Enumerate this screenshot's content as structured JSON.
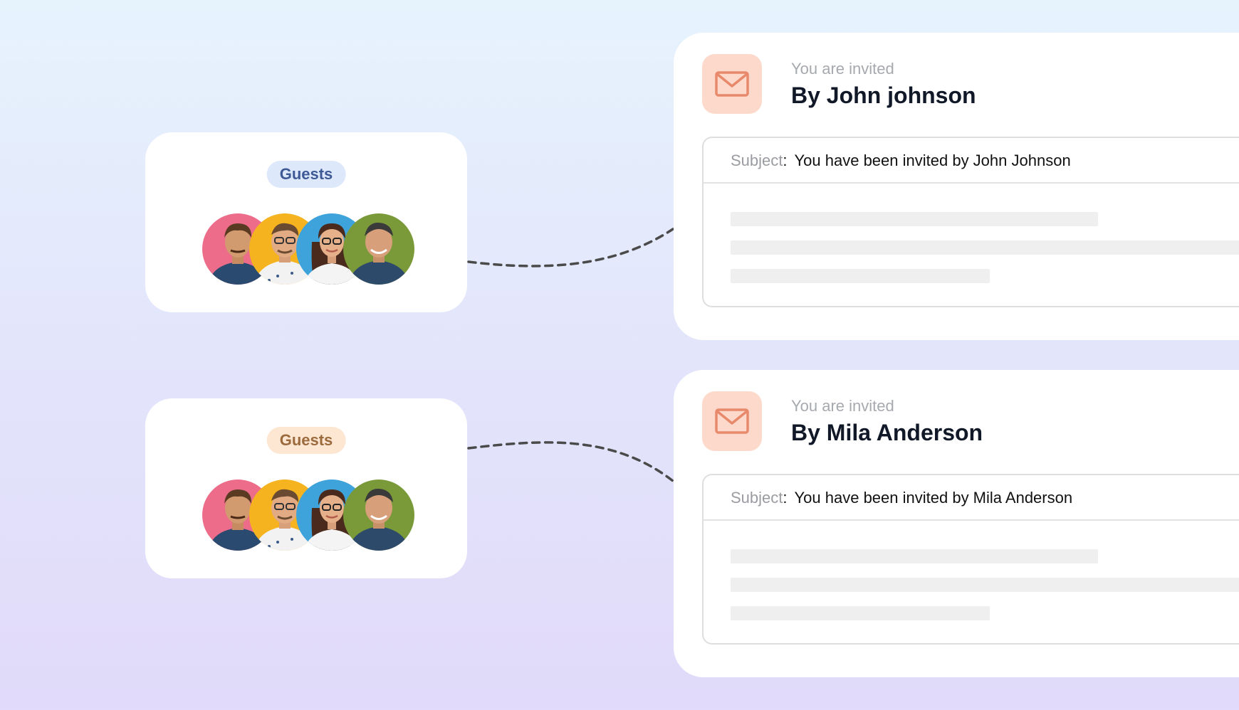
{
  "colors": {
    "background_top": "#e6f3fd",
    "background_bottom": "#e1dafa",
    "guest_pill_blue_bg": "#dde8fb",
    "guest_pill_blue_text": "#3d5a96",
    "guest_pill_orange_bg": "#fde6d2",
    "guest_pill_orange_text": "#9b6a3d",
    "mail_badge": "#fdd9cc",
    "mail_icon": "#e7896a"
  },
  "guest_groups": [
    {
      "label": "Guests",
      "avatars": [
        "avatar-pink",
        "avatar-yellow",
        "avatar-blue",
        "avatar-green"
      ]
    },
    {
      "label": "Guests",
      "avatars": [
        "avatar-pink",
        "avatar-yellow",
        "avatar-blue",
        "avatar-green"
      ]
    }
  ],
  "invites": [
    {
      "icon": "mail-icon",
      "kicker": "You are invited",
      "title": "By John johnson",
      "subject_label": "Subject",
      "subject_colon": ":",
      "subject": "You have been invited by John Johnson"
    },
    {
      "icon": "mail-icon",
      "kicker": "You are invited",
      "title": "By Mila Anderson",
      "subject_label": "Subject",
      "subject_colon": ":",
      "subject": "You have been invited by Mila Anderson"
    }
  ]
}
